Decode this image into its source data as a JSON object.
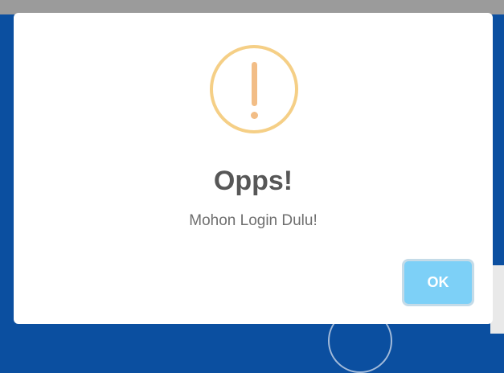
{
  "dialog": {
    "icon": "warning-exclamation-icon",
    "title": "Opps!",
    "message": "Mohon Login Dulu!",
    "ok_label": "OK"
  },
  "colors": {
    "backdrop": "#0b4fa0",
    "icon_ring": "#f5cf86",
    "icon_mark": "#f2bd86",
    "title": "#575757",
    "message": "#6f6f6f",
    "ok_button": "#7dd0f7"
  }
}
